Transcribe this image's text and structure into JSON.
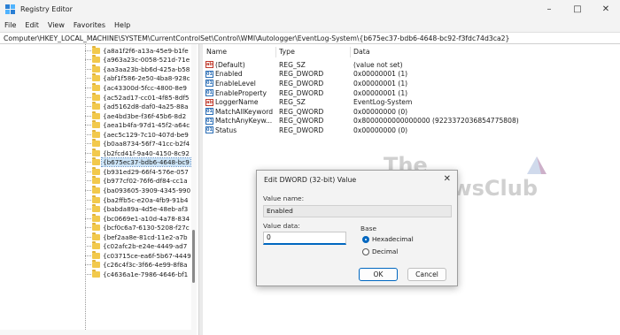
{
  "window": {
    "title": "Registry Editor"
  },
  "menu": [
    "File",
    "Edit",
    "View",
    "Favorites",
    "Help"
  ],
  "address": "Computer\\HKEY_LOCAL_MACHINE\\SYSTEM\\CurrentControlSet\\Control\\WMI\\Autologger\\EventLog-System\\{b675ec37-bdb6-4648-bc92-f3fdc74d3ca2}",
  "tree": {
    "items": [
      "{a8a1f2f6-a13a-45e9-b1fe",
      "{a963a23c-0058-521d-71e",
      "{aa3aa23b-bb6d-425a-b58",
      "{abf1f586-2e50-4ba8-928c",
      "{ac43300d-5fcc-4800-8e9",
      "{ac52ad17-cc01-4f85-8df5",
      "{ad5162d8-daf0-4a25-88a",
      "{ae4bd3be-f36f-45b6-8d2",
      "{aea1b4fa-97d1-45f2-a64c",
      "{aec5c129-7c10-407d-be9",
      "{b0aa8734-56f7-41cc-b2f4",
      "{b2fcd41f-9a40-4150-8c92",
      "{b675ec37-bdb6-4648-bc9",
      "{b931ed29-66f4-576e-057",
      "{b977cf02-76f6-df84-cc1a",
      "{ba093605-3909-4345-990",
      "{ba2ffb5c-e20a-4fb9-91b4",
      "{babda89a-4d5e-48eb-af3",
      "{bc0669e1-a10d-4a78-834",
      "{bcf0c6a7-6130-5208-f27c",
      "{bef2aa8e-81cd-11e2-a7b",
      "{c02afc2b-e24e-4449-ad7",
      "{c03715ce-ea6f-5b67-4449",
      "{c26c4f3c-3f66-4e99-8f8a",
      "{c4636a1e-7986-4646-bf1"
    ],
    "selected_index": 12
  },
  "values": {
    "columns": [
      "Name",
      "Type",
      "Data"
    ],
    "rows": [
      {
        "name": "(Default)",
        "type": "REG_SZ",
        "data": "(value not set)",
        "icon": "string-value-icon"
      },
      {
        "name": "Enabled",
        "type": "REG_DWORD",
        "data": "0x00000001 (1)",
        "icon": "binary-value-icon"
      },
      {
        "name": "EnableLevel",
        "type": "REG_DWORD",
        "data": "0x00000001 (1)",
        "icon": "binary-value-icon"
      },
      {
        "name": "EnableProperty",
        "type": "REG_DWORD",
        "data": "0x00000001 (1)",
        "icon": "binary-value-icon"
      },
      {
        "name": "LoggerName",
        "type": "REG_SZ",
        "data": "EventLog-System",
        "icon": "string-value-icon"
      },
      {
        "name": "MatchAllKeyword",
        "type": "REG_QWORD",
        "data": "0x00000000 (0)",
        "icon": "binary-value-icon"
      },
      {
        "name": "MatchAnyKeyw...",
        "type": "REG_QWORD",
        "data": "0x8000000000000000 (9223372036854775808)",
        "icon": "binary-value-icon"
      },
      {
        "name": "Status",
        "type": "REG_DWORD",
        "data": "0x00000000 (0)",
        "icon": "binary-value-icon"
      }
    ]
  },
  "dialog": {
    "title": "Edit DWORD (32-bit) Value",
    "value_name_label": "Value name:",
    "value_name": "Enabled",
    "value_data_label": "Value data:",
    "value_data": "0",
    "base_label": "Base",
    "base_options": [
      "Hexadecimal",
      "Decimal"
    ],
    "base_selected": "Hexadecimal",
    "ok_label": "OK",
    "cancel_label": "Cancel"
  },
  "watermark": {
    "line1": "The",
    "line2": "WindowsClub"
  },
  "colors": {
    "accent": "#0067c0",
    "selection": "#cce4f7",
    "folder": "#f2c94c"
  }
}
